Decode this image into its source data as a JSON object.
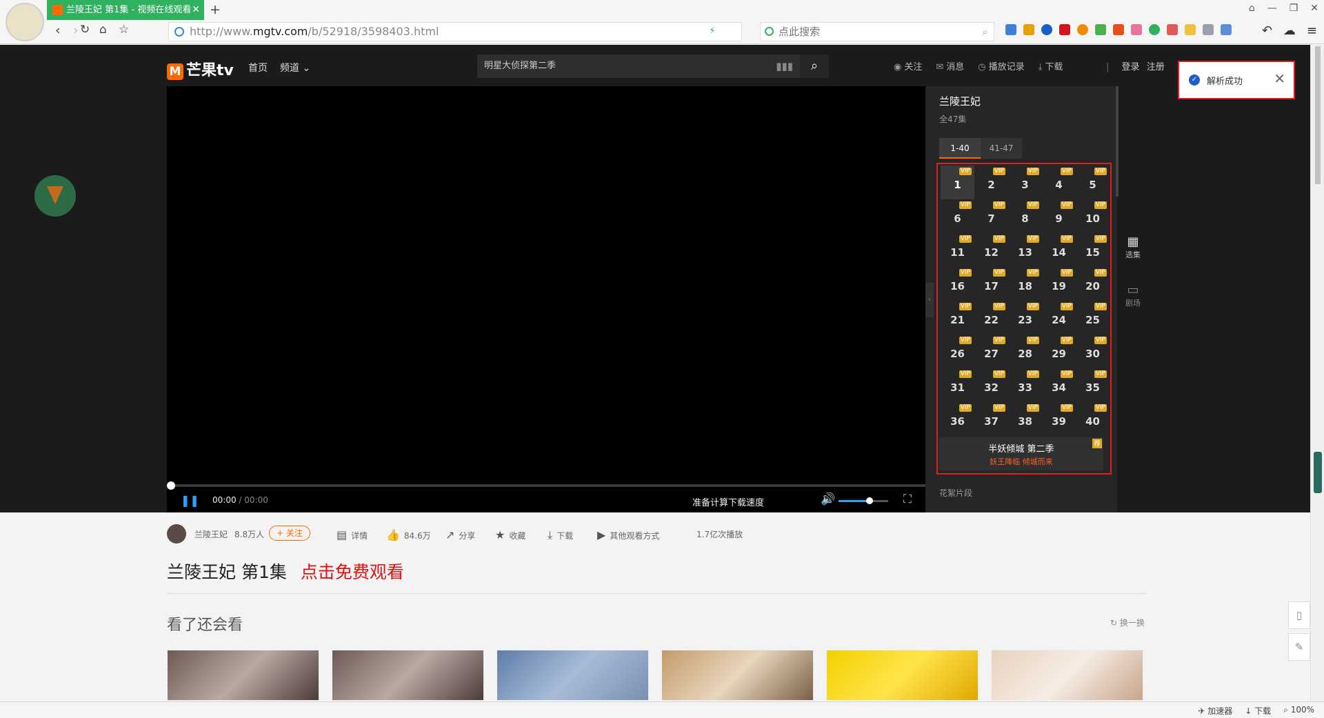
{
  "browser": {
    "tab_title": "兰陵王妃 第1集 - 视频在线观看",
    "url_prefix": "http://www.",
    "url_host": "mgtv.com",
    "url_path": "/b/52918/3598403.html",
    "search_placeholder": "点此搜索"
  },
  "site": {
    "logo_text": "芒果tv",
    "nav": [
      "首页",
      "频道"
    ],
    "search_value": "明星大侦探第二季",
    "top_links": [
      "关注",
      "消息",
      "播放记录",
      "下载"
    ],
    "login": "登录",
    "register": "注册"
  },
  "player": {
    "time_current": "00:00",
    "time_sep": "/",
    "time_total": "00:00",
    "status_text": "准备计算下载速度",
    "volume": 0.62
  },
  "side_panel": {
    "title": "兰陵王妃",
    "subtitle": "全47集",
    "range_tabs": [
      "1-40",
      "41-47"
    ],
    "vip_label": "VIP",
    "episodes": [
      "1",
      "2",
      "3",
      "4",
      "5",
      "6",
      "7",
      "8",
      "9",
      "10",
      "11",
      "12",
      "13",
      "14",
      "15",
      "16",
      "17",
      "18",
      "19",
      "20",
      "21",
      "22",
      "23",
      "24",
      "25",
      "26",
      "27",
      "28",
      "29",
      "30",
      "31",
      "32",
      "33",
      "34",
      "35",
      "36",
      "37",
      "38",
      "39",
      "40"
    ],
    "promo_title": "半妖倾城 第二季",
    "promo_subtitle": "妖王降临 倾城而来",
    "promo_tag": "荐",
    "section_label": "花絮片段",
    "rail": [
      "选集",
      "剧场"
    ]
  },
  "toast": {
    "message": "解析成功"
  },
  "info": {
    "channel": "兰陵王妃",
    "fans": "8.8万人",
    "follow": "+ 关注",
    "details": "详情",
    "likes": "84.6万",
    "share": "分享",
    "favorite": "收藏",
    "download": "下载",
    "other_ways": "其他观看方式",
    "plays": "1.7亿次播放"
  },
  "title": {
    "main": "兰陵王妃 第1集",
    "free": "点击免费观看"
  },
  "recommend": {
    "title": "看了还会看",
    "refresh": "换一换"
  },
  "status_bar": [
    "加速器",
    "下载",
    "100%"
  ],
  "colors": {
    "accent": "#ff6a00",
    "highlight": "#e02020",
    "player_blue": "#24a4ff",
    "tab_green": "#2fb160",
    "vip": "#e0a926"
  }
}
